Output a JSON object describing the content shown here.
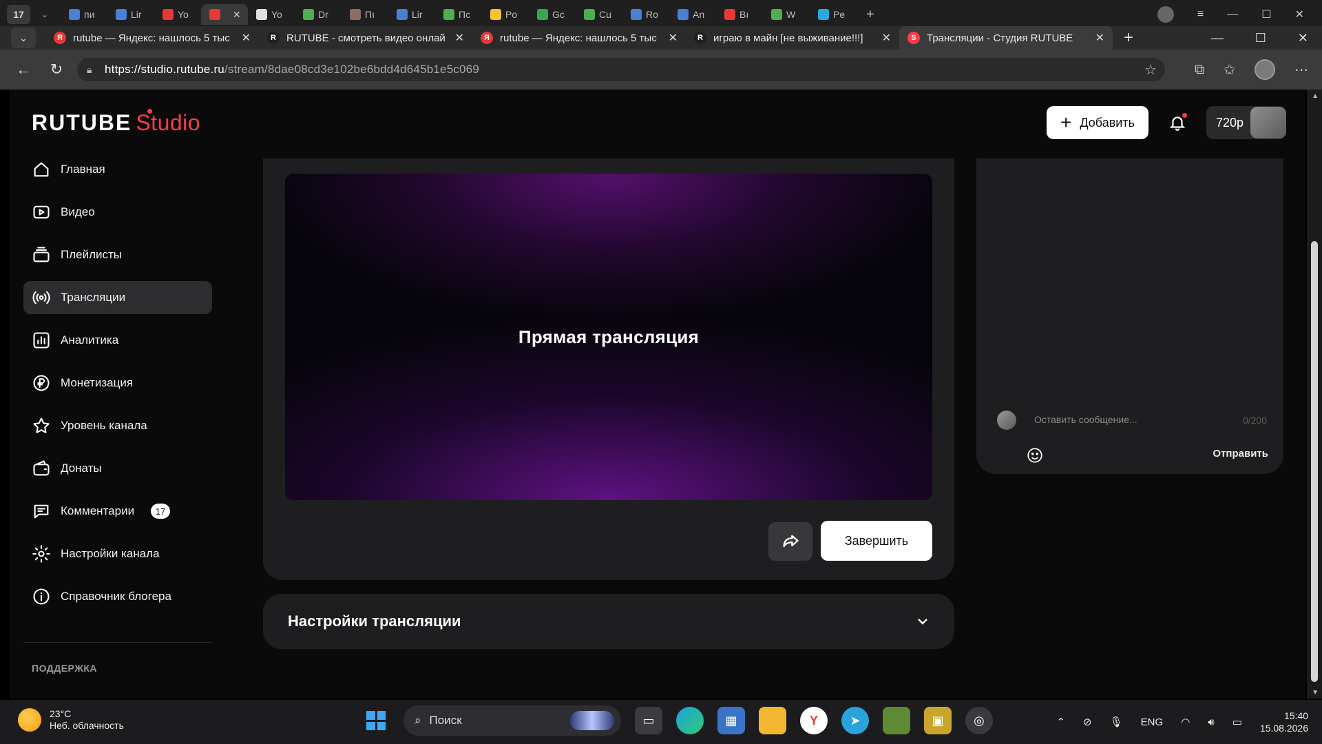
{
  "os_strip": {
    "workspace_count": "17",
    "mini_tabs": [
      {
        "label": "пи",
        "icon": "search-icon",
        "color": "#4a7fd6"
      },
      {
        "label": "Lir",
        "icon": "search-icon",
        "color": "#4a7fd6"
      },
      {
        "label": "Yo",
        "icon": "youtube-icon",
        "color": "#e53935"
      },
      {
        "label": "",
        "icon": "yandex-icon",
        "color": "#e53935",
        "active": true
      },
      {
        "label": "Yo",
        "icon": "youtube-icon",
        "color": "#e0e0e0"
      },
      {
        "label": "Dr",
        "icon": "minecraft-icon",
        "color": "#4caf50"
      },
      {
        "label": "Пı",
        "icon": "minecraft-icon",
        "color": "#8d6e63"
      },
      {
        "label": "Lir",
        "icon": "search-icon",
        "color": "#4a7fd6"
      },
      {
        "label": "Пс",
        "icon": "minecraft-icon",
        "color": "#4caf50"
      },
      {
        "label": "Po",
        "icon": "drive-icon",
        "color": "#fbc02d"
      },
      {
        "label": "Gc",
        "icon": "drive-icon",
        "color": "#34a853"
      },
      {
        "label": "Cu",
        "icon": "minecraft-icon",
        "color": "#4caf50"
      },
      {
        "label": "Ro",
        "icon": "search-icon",
        "color": "#4a7fd6"
      },
      {
        "label": "An",
        "icon": "search-icon",
        "color": "#4a7fd6"
      },
      {
        "label": "Bı",
        "icon": "youtube-icon",
        "color": "#e53935"
      },
      {
        "label": "W",
        "icon": "minecraft-icon",
        "color": "#4caf50"
      },
      {
        "label": "Pe",
        "icon": "tl-icon",
        "color": "#29a9e1"
      }
    ]
  },
  "browser": {
    "tabs": [
      {
        "label": "rutube — Яндекс: нашлось 5 тыс",
        "icon_text": "Я",
        "icon_color": "#e53935",
        "active": false
      },
      {
        "label": "RUTUBE - смотреть видео онлай",
        "icon_text": "R",
        "icon_color": "#1f1f1f",
        "active": false
      },
      {
        "label": "rutube — Яндекс: нашлось 5 тыс",
        "icon_text": "Я",
        "icon_color": "#e53935",
        "active": false
      },
      {
        "label": "играю в майн [не выживание!!!]",
        "icon_text": "R",
        "icon_color": "#1f1f1f",
        "active": false
      },
      {
        "label": "Трансляции - Студия RUTUBE",
        "icon_text": "S",
        "icon_color": "#ff3b4a",
        "active": true
      }
    ],
    "url_domain": "https://studio.rutube.ru",
    "url_path": "/stream/8dae08cd3e102be6bdd4d645b1e5c069"
  },
  "app": {
    "logo_main": "RUTUBE",
    "logo_studio": "Studio",
    "add_button_label": "Добавить",
    "quality_label": "720p",
    "accent_color": "#ff3b4a"
  },
  "sidebar": {
    "items": [
      {
        "key": "home",
        "label": "Главная",
        "icon": "home-icon"
      },
      {
        "key": "video",
        "label": "Видео",
        "icon": "video-icon"
      },
      {
        "key": "playlists",
        "label": "Плейлисты",
        "icon": "playlist-icon"
      },
      {
        "key": "streams",
        "label": "Трансляции",
        "icon": "broadcast-icon",
        "active": true
      },
      {
        "key": "analytics",
        "label": "Аналитика",
        "icon": "analytics-icon"
      },
      {
        "key": "monetization",
        "label": "Монетизация",
        "icon": "ruble-icon"
      },
      {
        "key": "channel-level",
        "label": "Уровень канала",
        "icon": "star-icon"
      },
      {
        "key": "donations",
        "label": "Донаты",
        "icon": "wallet-icon"
      },
      {
        "key": "comments",
        "label": "Комментарии",
        "icon": "comment-icon",
        "badge": "17"
      },
      {
        "key": "channel-settings",
        "label": "Настройки канала",
        "icon": "gear-icon"
      },
      {
        "key": "blogger-guide",
        "label": "Справочник блогера",
        "icon": "info-icon"
      }
    ],
    "support_label": "ПОДДЕРЖКА"
  },
  "stream": {
    "video_title": "Прямая трансляция",
    "finish_button_label": "Завершить",
    "settings_title": "Настройки трансляции"
  },
  "chat": {
    "input_placeholder": "Оставить сообщение...",
    "counter": "0/200",
    "send_label": "Отправить"
  },
  "taskbar": {
    "temperature": "23°C",
    "weather": "Неб. облачность",
    "search_label": "Поиск",
    "language": "ENG",
    "time": "15:40",
    "date": "15.08.2026"
  }
}
